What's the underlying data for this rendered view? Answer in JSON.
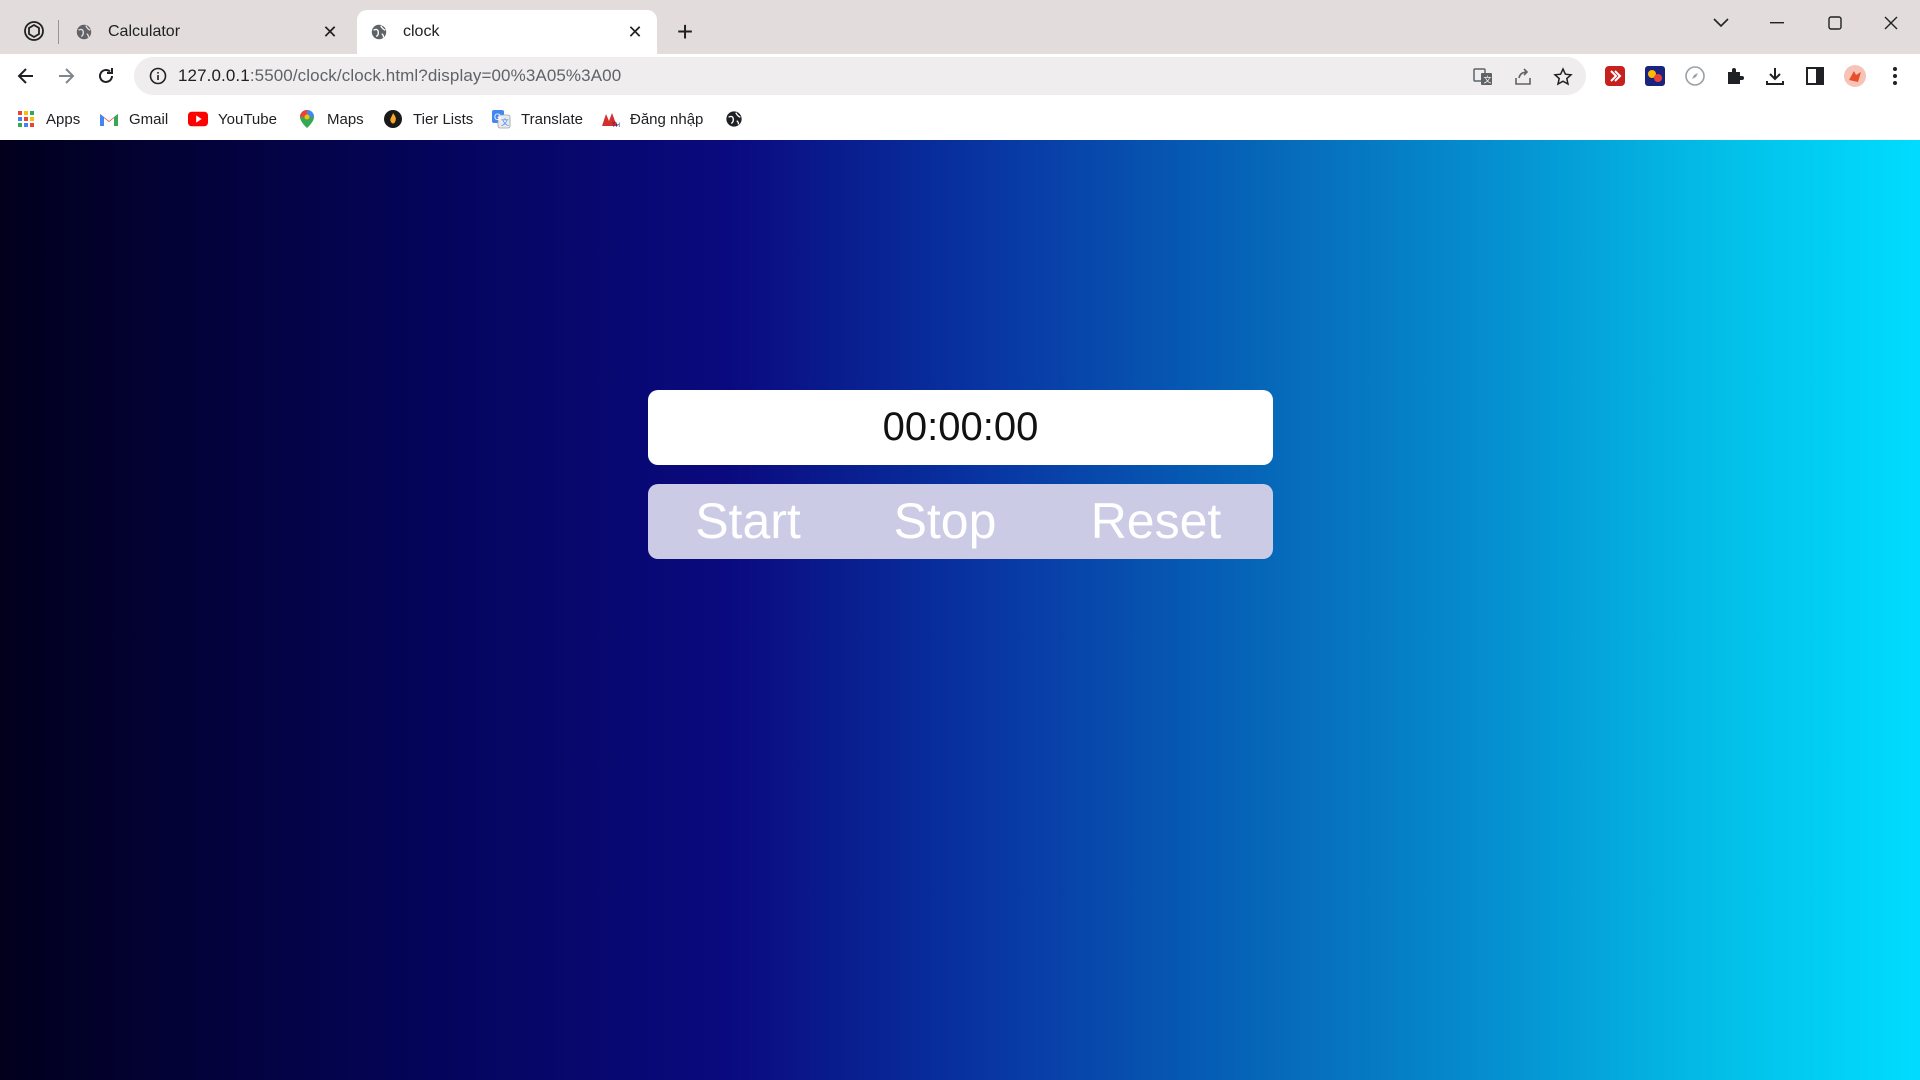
{
  "tabs": [
    {
      "title": "Calculator",
      "active": false
    },
    {
      "title": "clock",
      "active": true
    }
  ],
  "address_bar": {
    "host": "127.0.0.1",
    "path": ":5500/clock/clock.html?display=00%3A05%3A00"
  },
  "bookmarks": [
    {
      "label": "Apps",
      "icon": "apps-grid-icon"
    },
    {
      "label": "Gmail",
      "icon": "gmail-icon"
    },
    {
      "label": "YouTube",
      "icon": "youtube-icon"
    },
    {
      "label": "Maps",
      "icon": "maps-pin-icon"
    },
    {
      "label": "Tier Lists",
      "icon": "tier-lists-icon"
    },
    {
      "label": "Translate",
      "icon": "translate-icon"
    },
    {
      "label": "Đăng nhập",
      "icon": "login-site-icon"
    },
    {
      "label": "",
      "icon": "globe-icon"
    }
  ],
  "stopwatch": {
    "display": "00:00:00",
    "buttons": {
      "start": "Start",
      "stop": "Stop",
      "reset": "Reset"
    }
  },
  "colors": {
    "tabstrip_bg": "#e3dcdc",
    "page_gradient_start": "#02001c",
    "page_gradient_mid": "#0a0a7f",
    "page_gradient_end": "#00dcff",
    "controls_bg": "#cbcbe6"
  }
}
